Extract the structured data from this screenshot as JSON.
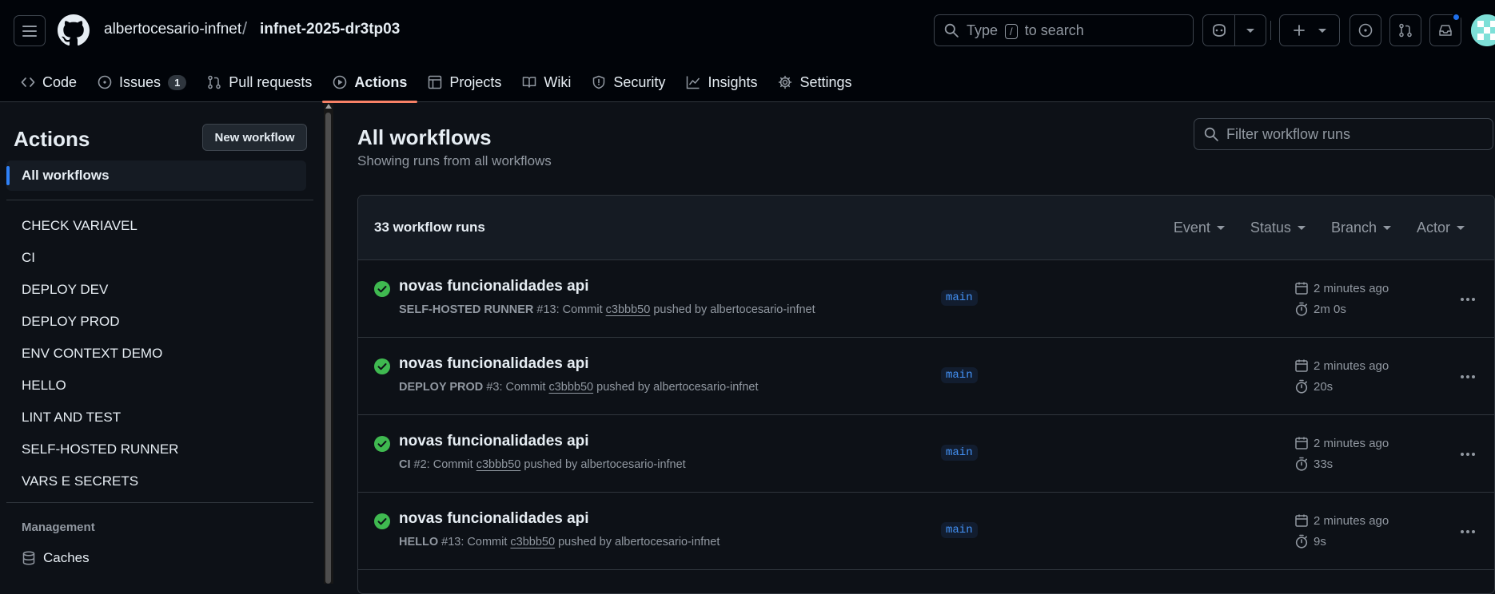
{
  "header": {
    "owner": "albertocesario-infnet",
    "separator": "/",
    "repo": "infnet-2025-dr3tp03",
    "search_prefix": "Type",
    "search_key": "/",
    "search_suffix": "to search"
  },
  "tabs": [
    {
      "label": "Code",
      "icon": "code-icon"
    },
    {
      "label": "Issues",
      "icon": "issue-icon",
      "count": "1"
    },
    {
      "label": "Pull requests",
      "icon": "pull-request-icon"
    },
    {
      "label": "Actions",
      "icon": "play-icon",
      "active": true
    },
    {
      "label": "Projects",
      "icon": "table-icon"
    },
    {
      "label": "Wiki",
      "icon": "book-icon"
    },
    {
      "label": "Security",
      "icon": "shield-icon"
    },
    {
      "label": "Insights",
      "icon": "graph-icon"
    },
    {
      "label": "Settings",
      "icon": "gear-icon"
    }
  ],
  "sidebar": {
    "title": "Actions",
    "new_workflow": "New workflow",
    "all_workflows": "All workflows",
    "workflows": [
      "CHECK VARIAVEL",
      "CI",
      "DEPLOY DEV",
      "DEPLOY PROD",
      "ENV CONTEXT DEMO",
      "HELLO",
      "LINT AND TEST",
      "SELF-HOSTED RUNNER",
      "VARS E SECRETS"
    ],
    "management_label": "Management",
    "caches": "Caches"
  },
  "main": {
    "title": "All workflows",
    "subtitle": "Showing runs from all workflows",
    "filter_placeholder": "Filter workflow runs",
    "count": "33 workflow runs",
    "filters": [
      "Event",
      "Status",
      "Branch",
      "Actor"
    ],
    "runs": [
      {
        "title": "novas funcionalidades api",
        "workflow": "SELF-HOSTED RUNNER",
        "number": "#13",
        "commit_label": ": Commit",
        "sha": "c3bbb50",
        "pushed_by": "pushed by albertocesario-infnet",
        "branch": "main",
        "when": "2 minutes ago",
        "duration": "2m 0s"
      },
      {
        "title": "novas funcionalidades api",
        "workflow": "DEPLOY PROD",
        "number": "#3",
        "commit_label": ": Commit",
        "sha": "c3bbb50",
        "pushed_by": "pushed by albertocesario-infnet",
        "branch": "main",
        "when": "2 minutes ago",
        "duration": "20s"
      },
      {
        "title": "novas funcionalidades api",
        "workflow": "CI",
        "number": "#2",
        "commit_label": ": Commit",
        "sha": "c3bbb50",
        "pushed_by": "pushed by albertocesario-infnet",
        "branch": "main",
        "when": "2 minutes ago",
        "duration": "33s"
      },
      {
        "title": "novas funcionalidades api",
        "workflow": "HELLO",
        "number": "#13",
        "commit_label": ": Commit",
        "sha": "c3bbb50",
        "pushed_by": "pushed by albertocesario-infnet",
        "branch": "main",
        "when": "2 minutes ago",
        "duration": "9s"
      }
    ]
  },
  "colors": {
    "accent": "#f78166",
    "success": "#3fb950",
    "link": "#4493f8",
    "bg": "#0d1117"
  }
}
